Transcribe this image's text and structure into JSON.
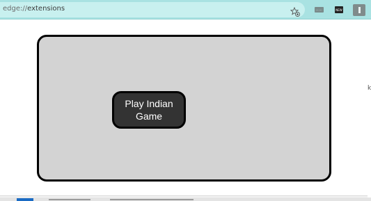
{
  "browser": {
    "url_scheme": "edge://",
    "url_path": "extensions",
    "favorites_icon": "star-add-icon",
    "extensions": [
      {
        "icon": "extension-logo-icon",
        "label": "·······"
      },
      {
        "icon": "extension-logo-icon",
        "label": "NEW"
      },
      {
        "icon": "extension-logo-icon",
        "label": ""
      }
    ]
  },
  "background": {
    "peek_letter": "k"
  },
  "popup": {
    "play_button_label": "Play Indian Game"
  },
  "colors": {
    "toolbar": "#a9e2e2",
    "card": "#d3d3d3",
    "button": "#333333",
    "button_text": "#ffffff"
  }
}
